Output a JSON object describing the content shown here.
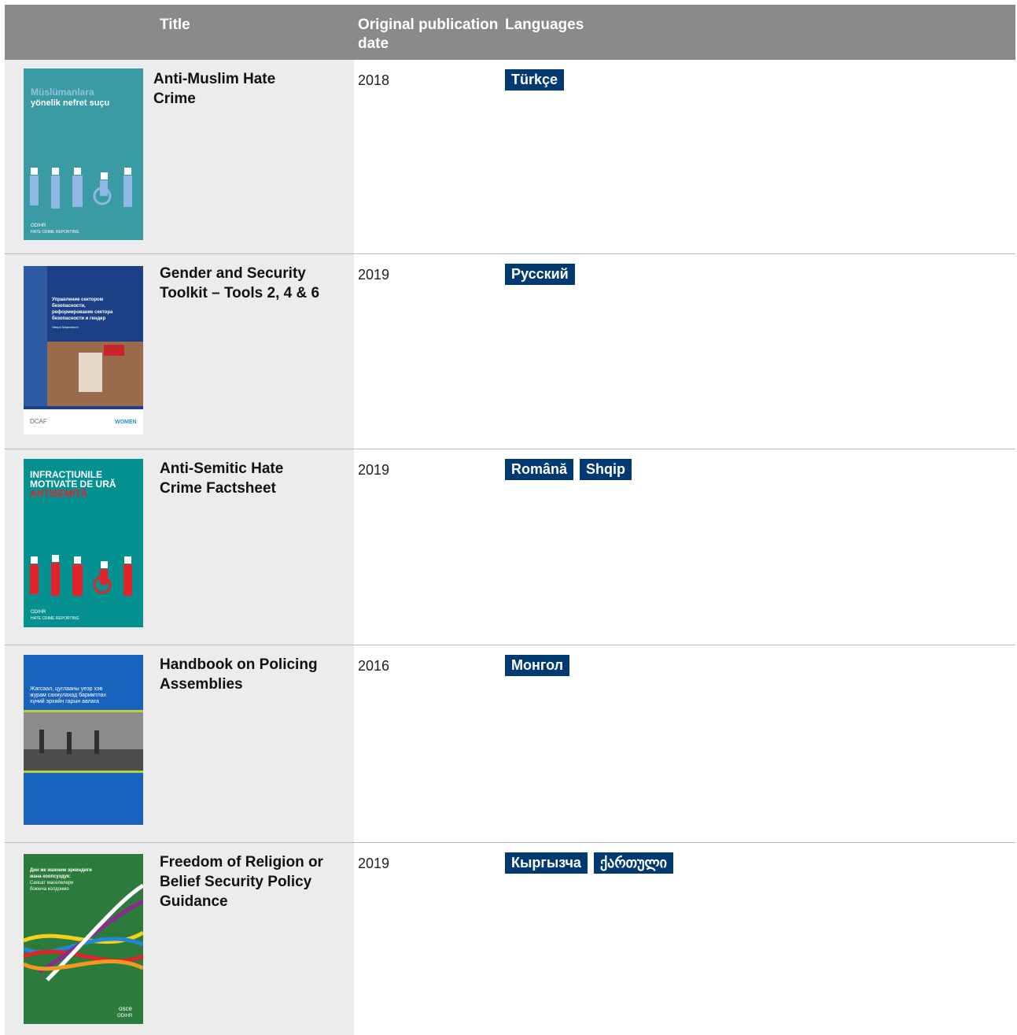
{
  "header": {
    "title": "Title",
    "date": "Original publication date",
    "languages": "Languages"
  },
  "colors": {
    "header_bg": "#8a8a8a",
    "lang_badge": "#003a70",
    "left_col_bg": "#ececec"
  },
  "rows": [
    {
      "title": "Anti-Muslim Hate Crime",
      "date": "2018",
      "languages": [
        "Türkçe"
      ],
      "cover": {
        "title_line1": "Müslümanlara",
        "title_line2": "yönelik nefret suçu",
        "footer1": "ODIHR",
        "footer2": "HATE CRIME REPORTING"
      }
    },
    {
      "title": "Gender and Security Toolkit – Tools 2, 4 & 6",
      "date": "2019",
      "languages": [
        "Русский"
      ],
      "cover": {
        "title_line1": "Управление сектором",
        "title_line2": "безопасности,",
        "title_line3": "реформирование сектора",
        "title_line4": "безопасности и гендер",
        "author": "Оверн Мартинелл",
        "logo1": "DCAF",
        "logo2": "WOMEN"
      }
    },
    {
      "title": "Anti-Semitic Hate Crime Factsheet",
      "date": "2019",
      "languages": [
        "Română",
        "Shqip"
      ],
      "cover": {
        "title_line1": "INFRACȚIUNILE",
        "title_line2": "MOTIVATE DE URĂ",
        "title_line3": "ANTISEMITĂ",
        "footer1": "ODIHR",
        "footer2": "HATE CRIME REPORTING"
      }
    },
    {
      "title": "Handbook on Policing Assemblies",
      "date": "2016",
      "languages": [
        "Монгол"
      ],
      "cover": {
        "title_line1": "Жагсаал, цуглааны үеэр хэв",
        "title_line2": "журам сахиулахад баримтлах",
        "title_line3": "хүний эрхийн гарын авлага"
      }
    },
    {
      "title": "Freedom of Religion or Belief Security Policy Guidance",
      "date": "2019",
      "languages": [
        "Кыргызча",
        "ქართული"
      ],
      "cover": {
        "title_line1": "Дин же ишеним эркиндиги",
        "title_line2": "жана коопсуздук:",
        "title_line3": "Саясат маселелери",
        "title_line4": "боюнча колдонмо",
        "logo1": "osce",
        "logo2": "ODIHR"
      }
    }
  ]
}
